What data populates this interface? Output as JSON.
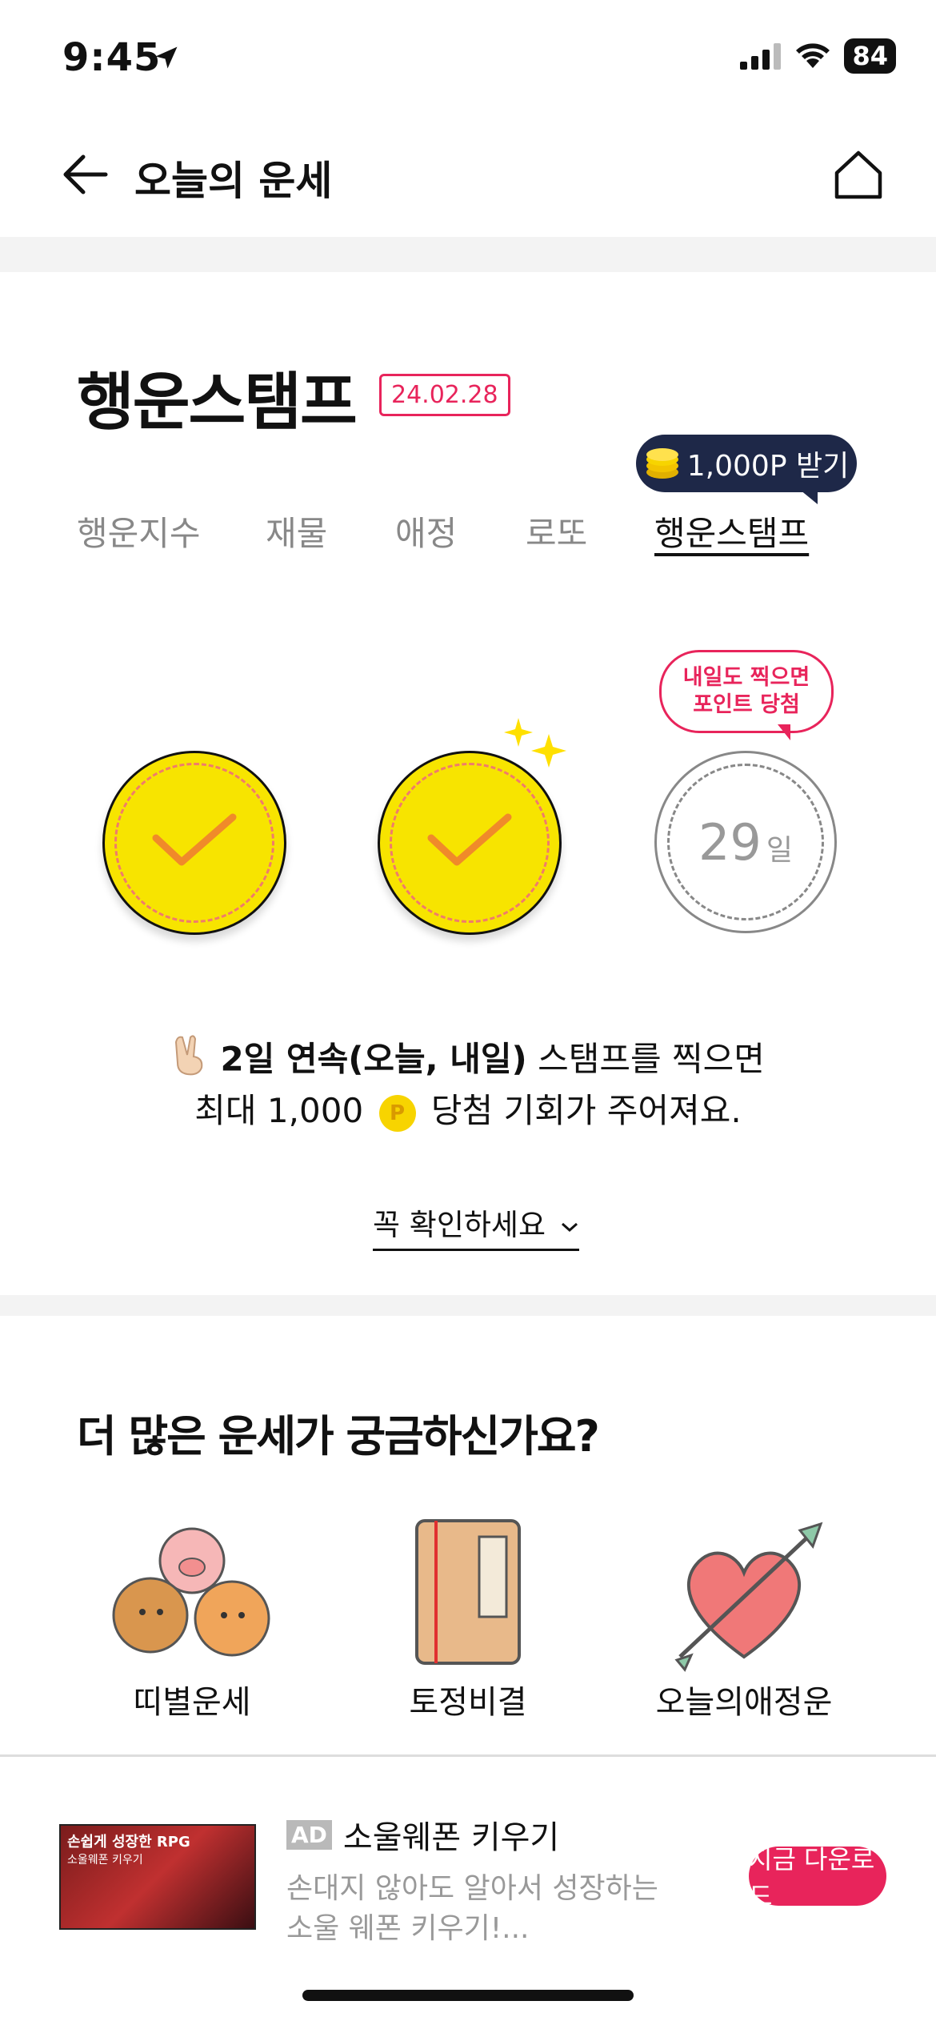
{
  "status": {
    "time": "9:45",
    "battery": "84"
  },
  "header": {
    "title": "오늘의 운세"
  },
  "stamp": {
    "title": "행운스탬프",
    "date": "24.02.28",
    "point_bubble": "1,000P 받기",
    "tabs": [
      "행운지수",
      "재물",
      "애정",
      "로또",
      "행운스탬프"
    ],
    "tooltip_line1": "내일도 찍으면",
    "tooltip_line2": "포인트 당첨",
    "day_number": "29",
    "day_unit": "일",
    "info_bold": "2일 연속(오늘, 내일)",
    "info_rest": " 스탬프를 찍으면",
    "info_line2_a": "최대 1,000",
    "info_line2_b": "당첨 기회가 주어져요.",
    "check_link": "꼭 확인하세요",
    "coin_glyph": "P"
  },
  "more": {
    "title": "더 많은 운세가 궁금하신가요?",
    "categories": [
      "띠별운세",
      "토정비결",
      "오늘의애정운"
    ]
  },
  "ad": {
    "tag": "AD",
    "title": "소울웨폰 키우기",
    "desc_line1": "손대지 않아도 알아서 성장하는",
    "desc_line2": "소울 웨폰 키우기!...",
    "button": "지금 다운로드",
    "thumb_line1": "손쉽게 성장한 RPG",
    "thumb_line2": "소울웨폰 키우기"
  }
}
